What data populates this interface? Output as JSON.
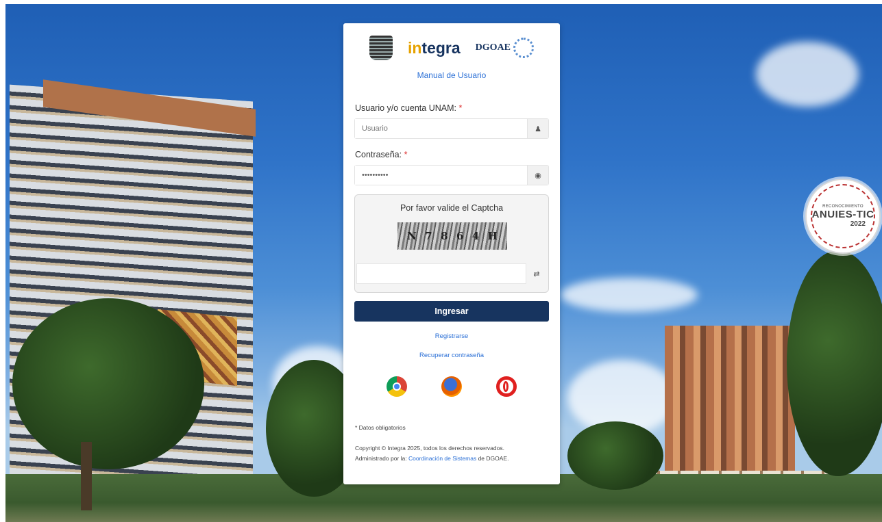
{
  "panel": {
    "logos": {
      "integra_prefix": "in",
      "integra_rest": "tegra",
      "dgoae": "DGOAE"
    },
    "manual_link": "Manual de Usuario",
    "user_label": "Usuario y/o cuenta UNAM:",
    "required_mark": "*",
    "user_placeholder": "Usuario",
    "password_label": "Contraseña:",
    "password_value": "••••••••••",
    "captcha_title": "Por favor valide el Captcha",
    "captcha_chars": [
      "N",
      "7",
      "8",
      "6",
      "4",
      "H"
    ],
    "login_button": "Ingresar",
    "register_link": "Registrarse",
    "recover_link": "Recuperar contraseña",
    "browser_icons": [
      "chrome-icon",
      "firefox-icon",
      "opera-icon"
    ],
    "required_note": "* Datos obligatorios",
    "copyright": "Copyright © Integra 2025, todos los derechos reservados.",
    "admin_prefix": "Administrado por la:",
    "admin_link": "Coordinación de Sistemas",
    "admin_suffix": "de DGOAE."
  },
  "badge": {
    "top": "RECONOCIMIENTO",
    "main": "ANUIES-TIC",
    "year": "2022"
  },
  "colors": {
    "primary": "#17345f",
    "link": "#2a6fd6",
    "required": "#d33333",
    "accent": "#e6a200"
  }
}
